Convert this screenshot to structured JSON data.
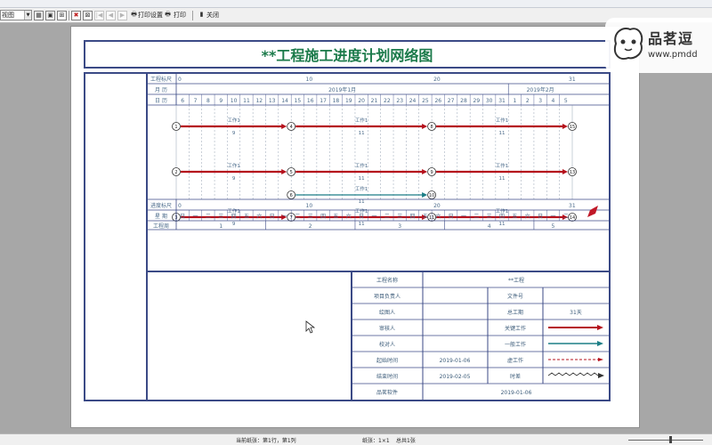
{
  "toolbar": {
    "view_select": "视图",
    "print_settings": "打印设置",
    "print": "打印",
    "close": "关闭"
  },
  "brand": {
    "name": "品茗逗",
    "url": "www.pmdd"
  },
  "chart": {
    "title": "**工程施工进度计划网络图",
    "row_labels": {
      "top_ruler": "工程标尺",
      "month": "月 历",
      "day": "日 历",
      "bottom_ruler": "进度标尺",
      "weekday": "星 期",
      "week_no": "工程周"
    },
    "months": [
      "2019年1月",
      "2019年2月"
    ],
    "days": [
      "6",
      "7",
      "8",
      "9",
      "10",
      "11",
      "12",
      "13",
      "14",
      "15",
      "16",
      "17",
      "18",
      "19",
      "20",
      "21",
      "22",
      "23",
      "24",
      "25",
      "26",
      "27",
      "28",
      "29",
      "30",
      "31",
      "1",
      "2",
      "3",
      "4",
      "5"
    ],
    "weekdays": [
      "日",
      "一",
      "二",
      "三",
      "四",
      "五",
      "六",
      "日",
      "一",
      "二",
      "三",
      "四",
      "五",
      "六",
      "日",
      "一",
      "二",
      "三",
      "四",
      "五",
      "六",
      "日",
      "一",
      "二",
      "三",
      "四",
      "五",
      "六",
      "日",
      "一",
      "二"
    ],
    "ruler_ticks": [
      "0",
      "10",
      "20",
      "31"
    ],
    "week_numbers": [
      "1",
      "2",
      "3",
      "4",
      "5"
    ],
    "arrow_top_label": "工作1",
    "arrow_dur_9": "9",
    "arrow_dur_11": "11",
    "nodes": [
      "1",
      "2",
      "3",
      "4",
      "5",
      "6",
      "7",
      "8",
      "9",
      "10",
      "11",
      "12",
      "13",
      "14",
      "15"
    ]
  },
  "info": {
    "project_name_label": "工程名称",
    "project_name_value": "**工程",
    "manager_label": "项目负责人",
    "doc_no_label": "文件号",
    "drafter_label": "绘图人",
    "duration_label": "总工期",
    "duration_value": "31天",
    "reviewer_label": "审核人",
    "critical_label": "关键工作",
    "checker_label": "校对人",
    "normal_label": "一般工作",
    "start_label": "起始时间",
    "start_value": "2019-01-06",
    "virtual_label": "虚工作",
    "end_label": "结束时间",
    "end_value": "2019-02-05",
    "float_label": "时差",
    "software_label": "品茗软件",
    "software_date": "2019-01-06"
  },
  "status": {
    "current": "当前纸张：第1行，第1列",
    "paper": "纸张：1×1",
    "total": "总共1张"
  },
  "colors": {
    "title_green": "#1b7a4a",
    "frame": "#3b4a86",
    "grid_text": "#4a6a8a",
    "critical": "#b5101c",
    "normal": "#1c7e86"
  }
}
